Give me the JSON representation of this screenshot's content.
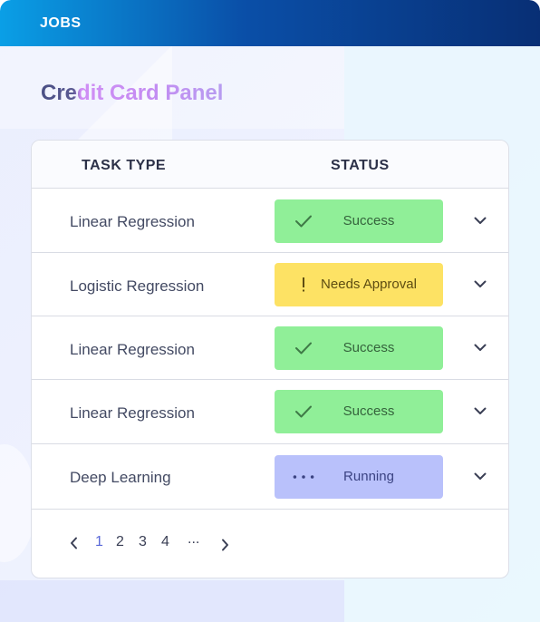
{
  "header": {
    "title": "JOBS"
  },
  "panel": {
    "title": "Credit Card Panel"
  },
  "table": {
    "columns": [
      "TASK TYPE",
      "STATUS"
    ],
    "rows": [
      {
        "task": "Linear Regression",
        "status": "Success",
        "status_kind": "success"
      },
      {
        "task": "Logistic Regression",
        "status": "Needs Approval",
        "status_kind": "warning"
      },
      {
        "task": "Linear Regression",
        "status": "Success",
        "status_kind": "success"
      },
      {
        "task": "Linear Regression",
        "status": "Success",
        "status_kind": "success"
      },
      {
        "task": "Deep Learning",
        "status": "Running",
        "status_kind": "running"
      }
    ]
  },
  "pagination": {
    "pages": [
      "1",
      "2",
      "3",
      "4"
    ],
    "current": "1",
    "ellipsis": "..."
  },
  "colors": {
    "header_start": "#0a9fe6",
    "header_end": "#082f75",
    "success": "#90ef98",
    "warning": "#fde264",
    "running": "#b9c1fb",
    "active_page": "#5a68d8"
  },
  "icons": {
    "success": "check-icon",
    "warning": "exclamation-icon",
    "running": "dots-icon",
    "expand": "chevron-down-icon",
    "prev": "chevron-left-icon",
    "next": "chevron-right-icon"
  }
}
